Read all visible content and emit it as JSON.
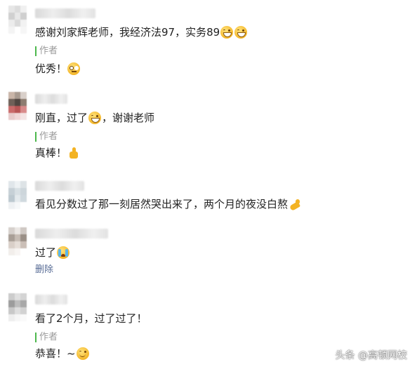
{
  "comments": [
    {
      "text": "感谢刘家辉老师，我经济法97，实务89",
      "emojis": [
        "grinning-face-icon",
        "grinning-face-icon"
      ],
      "author_label": "作者",
      "reply": "优秀！",
      "reply_emoji": "thinking-face-icon"
    },
    {
      "text_before": "刚直，过了",
      "text_after": "，谢谢老师",
      "emoji": "grinning-face-icon",
      "author_label": "作者",
      "reply": "真棒！",
      "reply_emoji": "thumbs-up-icon"
    },
    {
      "text": "看见分数过了那一刻居然哭出来了，两个月的夜没白熬",
      "emoji": "flexed-biceps-icon"
    },
    {
      "text": "过了",
      "emoji": "crying-face-icon",
      "delete_label": "删除"
    },
    {
      "text": "看了2个月，过了过了！",
      "author_label": "作者",
      "reply": "恭喜！~",
      "reply_emoji": "smiling-face-icon"
    }
  ],
  "watermark": "头条 @高顿网校",
  "colors": {
    "author_bar": "#4cb84c",
    "link": "#576b95",
    "text": "#222222",
    "muted": "#9a9a9a"
  }
}
